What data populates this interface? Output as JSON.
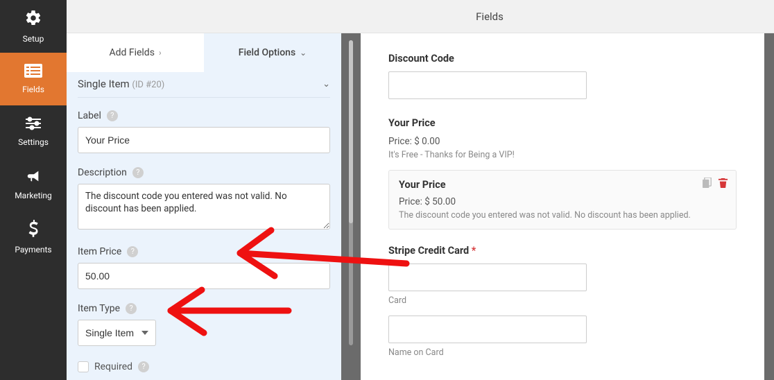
{
  "nav": {
    "items": [
      {
        "label": "Setup"
      },
      {
        "label": "Fields"
      },
      {
        "label": "Settings"
      },
      {
        "label": "Marketing"
      },
      {
        "label": "Payments"
      }
    ]
  },
  "header": {
    "title": "Fields"
  },
  "tabs": {
    "add": "Add Fields",
    "options": "Field Options"
  },
  "field_options": {
    "heading": "Single Item",
    "id_text": "(ID #20)",
    "label_lbl": "Label",
    "label_val": "Your Price",
    "desc_lbl": "Description",
    "desc_val": "The discount code you entered was not valid. No discount has been applied.",
    "price_lbl": "Item Price",
    "price_val": "50.00",
    "type_lbl": "Item Type",
    "type_val": "Single Item",
    "required_lbl": "Required"
  },
  "preview": {
    "discount_lbl": "Discount Code",
    "price_section1": {
      "title": "Your Price",
      "price": "Price: $ 0.00",
      "desc": "It's Free - Thanks for Being a VIP!"
    },
    "price_section2": {
      "title": "Your Price",
      "price": "Price: $ 50.00",
      "desc": "The discount code you entered was not valid. No discount has been applied."
    },
    "stripe_lbl": "Stripe Credit Card",
    "card_under": "Card",
    "name_under": "Name on Card"
  }
}
